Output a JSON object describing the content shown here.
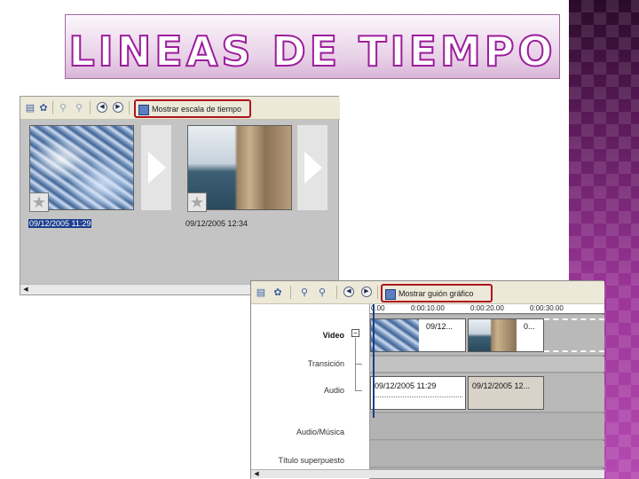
{
  "slide": {
    "title": "LINEAS DE TIEMPO"
  },
  "storyboard": {
    "toolbar": {
      "highlight_label": "Mostrar escala de tiempo"
    },
    "clips": [
      {
        "date": "09/12/2005 11:29"
      },
      {
        "date": "09/12/2005 12:34"
      }
    ]
  },
  "timeline": {
    "toolbar": {
      "highlight_label": "Mostrar guión gráfico"
    },
    "ruler": [
      "0.00",
      "0:00:10.00",
      "0:00:20.00",
      "0:00:30.00"
    ],
    "tracks": {
      "video": "Video",
      "transition": "Transición",
      "audio": "Audio",
      "music": "Audio/Música",
      "title_overlay": "Título superpuesto"
    },
    "video_clips": [
      "09/12...",
      "0..."
    ],
    "audio_clips": [
      "09/12/2005 11:29",
      "09/12/2005 12..."
    ]
  }
}
